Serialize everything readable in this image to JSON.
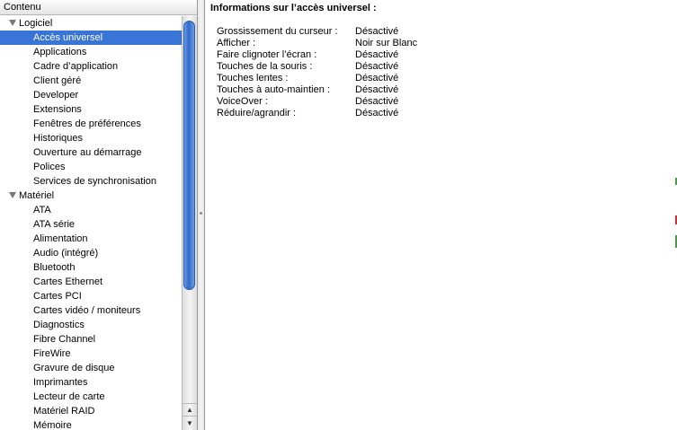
{
  "sidebar": {
    "header": "Contenu",
    "groups": [
      {
        "label": "Logiciel",
        "items": [
          "Accès universel",
          "Applications",
          "Cadre d’application",
          "Client géré",
          "Developer",
          "Extensions",
          "Fenêtres de préférences",
          "Historiques",
          "Ouverture au démarrage",
          "Polices",
          "Services de synchronisation"
        ]
      },
      {
        "label": "Matériel",
        "items": [
          "ATA",
          "ATA série",
          "Alimentation",
          "Audio (intégré)",
          "Bluetooth",
          "Cartes Ethernet",
          "Cartes PCI",
          "Cartes vidéo / moniteurs",
          "Diagnostics",
          "Fibre Channel",
          "FireWire",
          "Gravure de disque",
          "Imprimantes",
          "Lecteur de carte",
          "Matériel RAID",
          "Mémoire"
        ]
      }
    ],
    "selected": "Accès universel",
    "scroll_up_glyph": "▲",
    "scroll_down_glyph": "▼"
  },
  "content": {
    "title": "Informations sur l’accès universel :",
    "rows": [
      {
        "label": "Grossissement du curseur :",
        "value": "Désactivé"
      },
      {
        "label": "Afficher :",
        "value": "Noir sur Blanc"
      },
      {
        "label": "Faire clignoter l’écran :",
        "value": "Désactivé"
      },
      {
        "label": "Touches de la souris :",
        "value": "Désactivé"
      },
      {
        "label": "Touches lentes :",
        "value": "Désactivé"
      },
      {
        "label": "Touches à auto-maintien :",
        "value": "Désactivé"
      },
      {
        "label": "VoiceOver :",
        "value": "Désactivé"
      },
      {
        "label": "Réduire/agrandir :",
        "value": "Désactivé"
      }
    ]
  },
  "colors": {
    "selection": "#3875d7",
    "scroll_thumb": "#2f6acb"
  }
}
